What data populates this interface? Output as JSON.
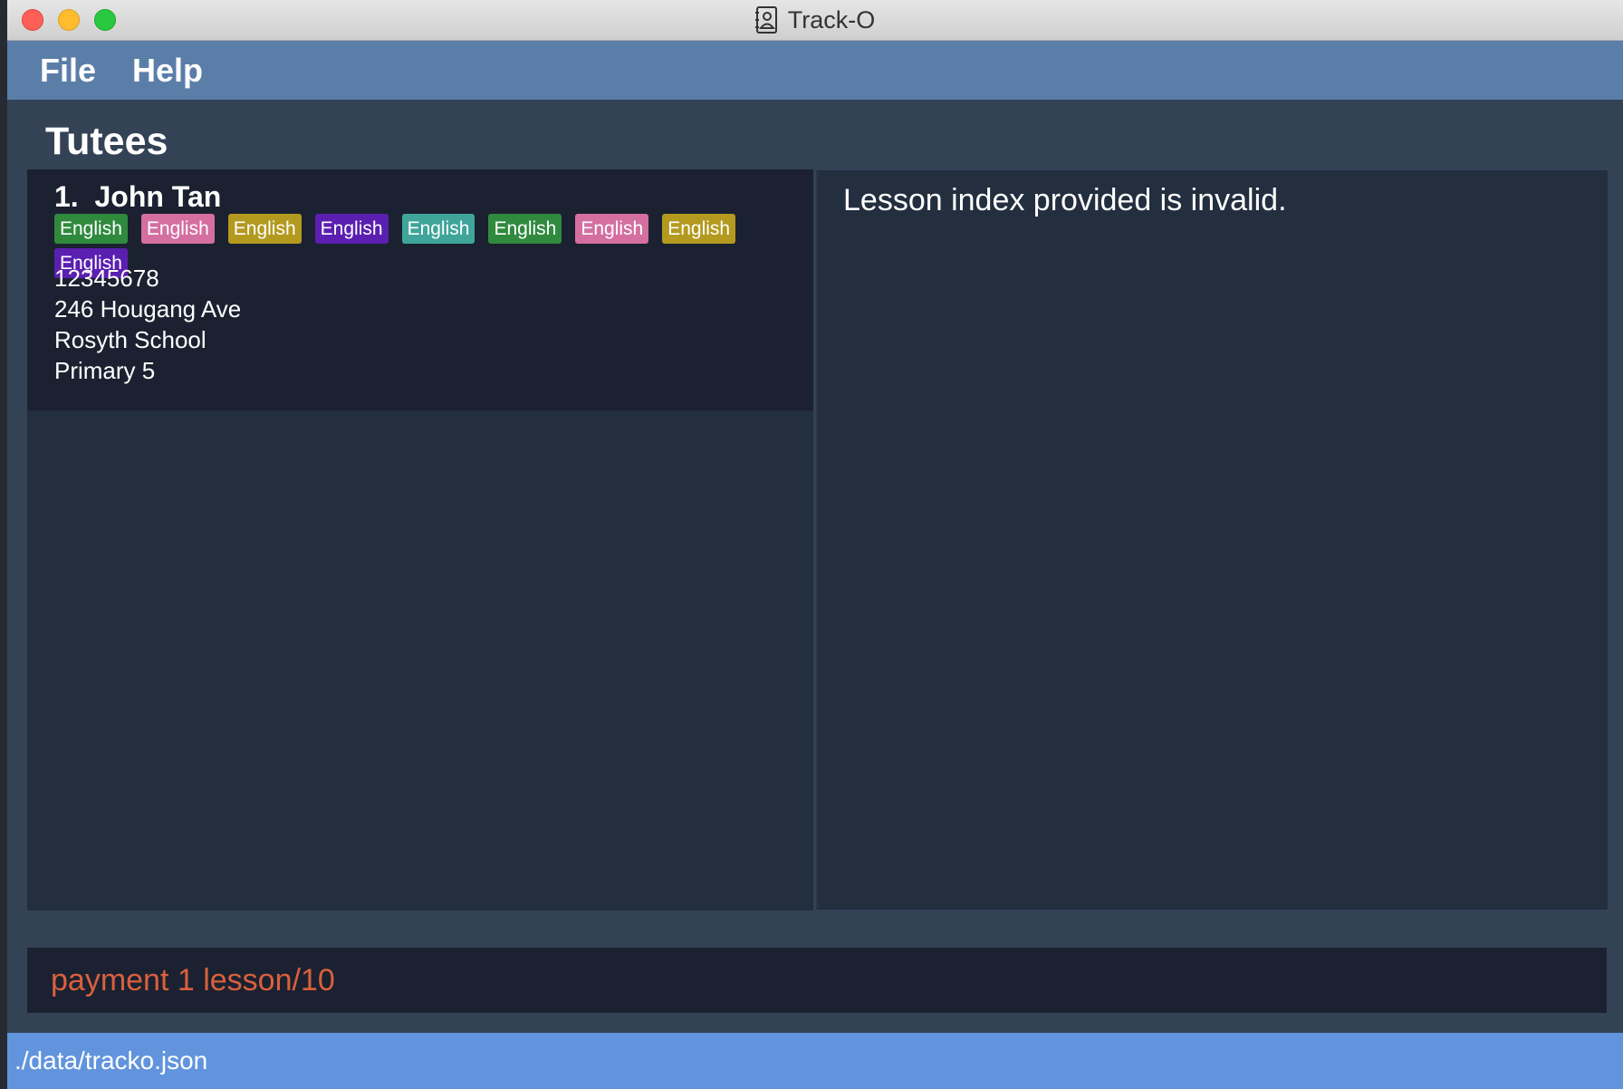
{
  "window": {
    "title": "Track-O",
    "app_icon": "address-book-icon"
  },
  "menu": {
    "items": [
      "File",
      "Help"
    ]
  },
  "tutees": {
    "title": "Tutees",
    "cards": [
      {
        "index": "1.",
        "name": "John Tan",
        "tags": [
          {
            "label": "English",
            "color": "#2f8a3e"
          },
          {
            "label": "English",
            "color": "#d46fa0"
          },
          {
            "label": "English",
            "color": "#b39a1f"
          },
          {
            "label": "English",
            "color": "#5a1fb0"
          },
          {
            "label": "English",
            "color": "#3fa59a"
          },
          {
            "label": "English",
            "color": "#2f8a3e"
          },
          {
            "label": "English",
            "color": "#d46fa0"
          },
          {
            "label": "English",
            "color": "#b39a1f"
          },
          {
            "label": "English",
            "color": "#5a1fb0"
          }
        ],
        "phone": "12345678",
        "address": "246 Hougang Ave",
        "school": "Rosyth School",
        "level": "Primary 5"
      }
    ]
  },
  "result": {
    "message": "Lesson index provided is invalid."
  },
  "command": {
    "value": "payment 1 lesson/10",
    "error_color": "#d9603e"
  },
  "status": {
    "file_path": "./data/tracko.json"
  },
  "colors": {
    "menubar": "#5a7ea8",
    "statusbar": "#6194dd",
    "background": "#344256"
  }
}
